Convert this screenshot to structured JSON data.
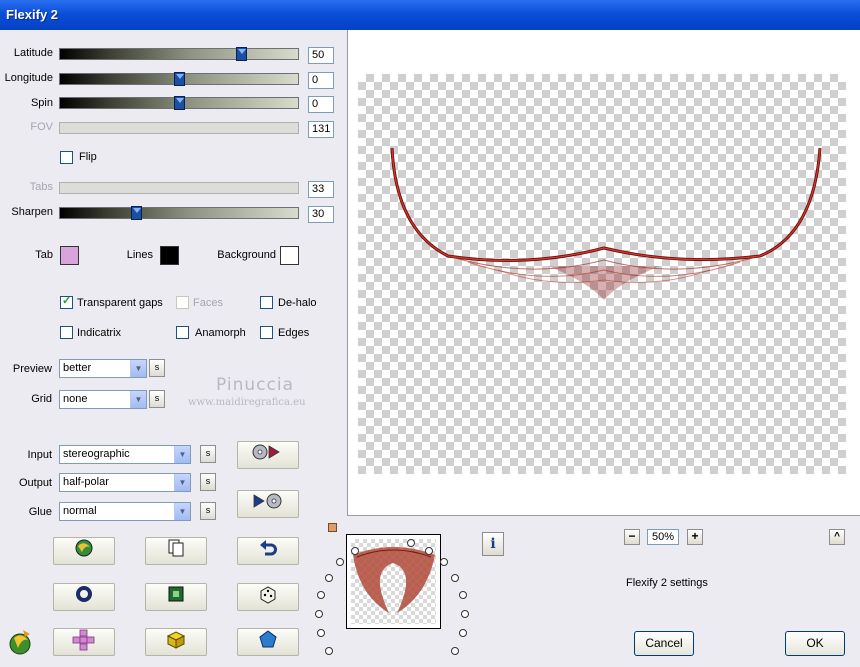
{
  "window": {
    "title": "Flexify 2"
  },
  "sliders": {
    "latitude": {
      "label": "Latitude",
      "value": "50",
      "level": 0.77
    },
    "longitude": {
      "label": "Longitude",
      "value": "0",
      "level": 0.5
    },
    "spin": {
      "label": "Spin",
      "value": "0",
      "level": 0.5
    },
    "fov": {
      "label": "FOV",
      "value": "131"
    },
    "tabs": {
      "label": "Tabs",
      "value": "33"
    },
    "sharpen": {
      "label": "Sharpen",
      "value": "30",
      "level": 0.31
    }
  },
  "flip": {
    "label": "Flip",
    "checked": false
  },
  "colors": {
    "tab": {
      "label": "Tab",
      "color": "#d9a4dc"
    },
    "lines": {
      "label": "Lines",
      "color": "#000000"
    },
    "background": {
      "label": "Background",
      "color": "#ffffff"
    }
  },
  "options": {
    "transparent_gaps": "Transparent gaps",
    "faces": "Faces",
    "de_halo": "De-halo",
    "indicatrix": "Indicatrix",
    "anamorph": "Anamorph",
    "edges": "Edges"
  },
  "preview": {
    "label": "Preview",
    "value": "better",
    "s_label": "s"
  },
  "grid": {
    "label": "Grid",
    "value": "none",
    "s_label": "s"
  },
  "watermark": {
    "line1": "Pinuccia",
    "line2": "www.maidiregrafica.eu"
  },
  "projection": {
    "input": {
      "label": "Input",
      "value": "stereographic",
      "s_label": "s"
    },
    "output": {
      "label": "Output",
      "value": "half-polar",
      "s_label": "s"
    },
    "glue": {
      "label": "Glue",
      "value": "normal",
      "s_label": "s"
    }
  },
  "icons": {
    "swap_forward": "cd-arrow-right-icon",
    "swap_back": "arrow-cd-icon",
    "randomize_globe": "globe-icon",
    "copy": "copy-pages-icon",
    "undo": "undo-arrow-icon",
    "ring": "ring-icon",
    "square": "square-frame-icon",
    "dice": "dice-icon",
    "logo": "flexify-logo-icon",
    "cross": "cross-net-icon",
    "cube": "cube-icon",
    "pentagon": "pentagon-icon",
    "info": "info-icon"
  },
  "zoom": {
    "minus": "−",
    "value": "50%",
    "plus": "+",
    "up": "^"
  },
  "status": "Flexify 2 settings",
  "buttons": {
    "cancel": "Cancel",
    "ok": "OK"
  }
}
